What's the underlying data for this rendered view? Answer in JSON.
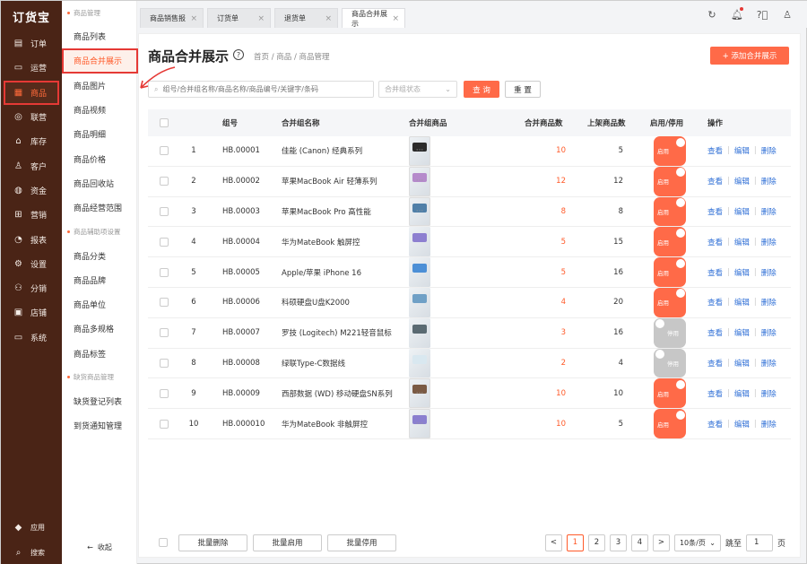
{
  "brand": "订货宝",
  "nav": [
    {
      "icon": "orders-icon",
      "glyph": "▤",
      "label": "订单"
    },
    {
      "icon": "operations-icon",
      "glyph": "▭",
      "label": "运营"
    },
    {
      "icon": "products-icon",
      "glyph": "▦",
      "label": "商品"
    },
    {
      "icon": "alliance-icon",
      "glyph": "◎",
      "label": "联营"
    },
    {
      "icon": "warehouse-icon",
      "glyph": "⌂",
      "label": "库存"
    },
    {
      "icon": "customer-icon",
      "glyph": "♙",
      "label": "客户"
    },
    {
      "icon": "funds-icon",
      "glyph": "◍",
      "label": "资金"
    },
    {
      "icon": "marketing-icon",
      "glyph": "⊞",
      "label": "营销"
    },
    {
      "icon": "report-icon",
      "glyph": "◔",
      "label": "报表"
    },
    {
      "icon": "settings-icon",
      "glyph": "⚙",
      "label": "设置"
    },
    {
      "icon": "distribution-icon",
      "glyph": "⚇",
      "label": "分销"
    },
    {
      "icon": "store-icon",
      "glyph": "▣",
      "label": "店铺"
    },
    {
      "icon": "system-icon",
      "glyph": "▭",
      "label": "系统"
    }
  ],
  "nav_bottom": [
    {
      "icon": "apps-icon",
      "glyph": "◆",
      "label": "应用"
    },
    {
      "icon": "search-icon",
      "glyph": "⌕",
      "label": "搜索"
    }
  ],
  "sub": {
    "group1": "商品管理",
    "group1_items": [
      "商品列表",
      "商品合并展示",
      "商品图片",
      "商品视频",
      "商品明细",
      "商品价格",
      "商品回收站",
      "商品经营范围"
    ],
    "group2": "商品辅助项设置",
    "group2_items": [
      "商品分类",
      "商品品牌",
      "商品单位",
      "商品多规格",
      "商品标签"
    ],
    "group3": "缺货商品管理",
    "group3_items": [
      "缺货登记列表",
      "到货通知管理"
    ],
    "collapse": "收起"
  },
  "tabs": [
    {
      "label": "商品销售报",
      "close": "×"
    },
    {
      "label": "订货单",
      "close": "×"
    },
    {
      "label": "退货单",
      "close": "×"
    },
    {
      "label": "商品合并展示",
      "close": "×"
    }
  ],
  "page": {
    "title": "商品合并展示",
    "breadcrumb": "首页 / 商品 / 商品管理",
    "add_button": "+ 添加合并展示",
    "search_placeholder": "组号/合并组名称/商品名称/商品编号/关键字/条码",
    "status_placeholder": "合并组状态",
    "query_button": "查 询",
    "reset_button": "重 置"
  },
  "table": {
    "headers": {
      "code": "组号",
      "name": "合并组名称",
      "goods": "合并组商品",
      "count": "合并商品数",
      "shelf": "上架商品数",
      "status": "启用/停用",
      "ops": "操作"
    },
    "on_label": "启用",
    "off_label": "停用",
    "op_view": "查看",
    "op_edit": "编辑",
    "op_delete": "删除",
    "more": "···",
    "rows": [
      {
        "idx": "1",
        "code": "HB.00001",
        "name": "佳能 (Canon) 经典系列",
        "count": "10",
        "shelf": "5",
        "on": true,
        "thumbs": [
          "#3a3a3a",
          "#6fa6c9",
          "#2b2b2b"
        ],
        "more": true
      },
      {
        "idx": "2",
        "code": "HB.00002",
        "name": "苹果MacBook Air 轻薄系列",
        "count": "12",
        "shelf": "12",
        "on": true,
        "thumbs": [
          "#3c4f7a",
          "#c9b79c",
          "#b58acb"
        ],
        "more": true
      },
      {
        "idx": "3",
        "code": "HB.00003",
        "name": "苹果MacBook Pro 高性能",
        "count": "8",
        "shelf": "8",
        "on": true,
        "thumbs": [
          "#2e3c5c",
          "#8fb3c9",
          "#4f7fa8"
        ],
        "more": true
      },
      {
        "idx": "4",
        "code": "HB.00004",
        "name": "华为MateBook 触屏控",
        "count": "5",
        "shelf": "15",
        "on": true,
        "thumbs": [
          "#8fc1d9",
          "#e59a4a",
          "#8d7fd0"
        ],
        "more": false
      },
      {
        "idx": "5",
        "code": "HB.00005",
        "name": "Apple/苹果 iPhone 16",
        "count": "5",
        "shelf": "16",
        "on": true,
        "thumbs": [
          "#5f7fc9",
          "#6b4fb8",
          "#4c8fd6"
        ],
        "more": false
      },
      {
        "idx": "6",
        "code": "HB.00006",
        "name": "科硕硬盘U盘K2000",
        "count": "4",
        "shelf": "20",
        "on": true,
        "thumbs": [
          "#3d4b58",
          "#2a2a2a",
          "#6fa0c6"
        ],
        "more": false
      },
      {
        "idx": "7",
        "code": "HB.00007",
        "name": "罗技 (Logitech) M221轻音鼠标",
        "count": "3",
        "shelf": "16",
        "on": false,
        "thumbs": [
          "#b9b9b9",
          "#5a6a72"
        ],
        "more": false
      },
      {
        "idx": "8",
        "code": "HB.00008",
        "name": "绿联Type-C数据线",
        "count": "2",
        "shelf": "4",
        "on": false,
        "thumbs": [
          "#9fc8dc",
          "#d9e8f0"
        ],
        "more": false
      },
      {
        "idx": "9",
        "code": "HB.00009",
        "name": "西部数据 (WD) 移动硬盘SN系列",
        "count": "10",
        "shelf": "10",
        "on": true,
        "thumbs": [
          "#aab8c4",
          "#3f6e8a",
          "#7a5a44"
        ],
        "more": true
      },
      {
        "idx": "10",
        "code": "HB.000010",
        "name": "华为MateBook 非触屏控",
        "count": "10",
        "shelf": "5",
        "on": true,
        "thumbs": [
          "#6a5aa8",
          "#4a8fc0",
          "#8a7fcf"
        ],
        "more": true
      }
    ]
  },
  "footer": {
    "batch_delete": "批量删除",
    "batch_enable": "批量启用",
    "batch_disable": "批量停用",
    "prev": "<",
    "next": ">",
    "pages": [
      "1",
      "2",
      "3",
      "4"
    ],
    "current_page": "1",
    "page_size": "10条/页",
    "jump_label": "跳至",
    "jump_value": "1",
    "page_unit": "页"
  },
  "colors": {
    "accent": "#ff6a48",
    "nav_bg": "#4a2416",
    "highlight": "#e53935",
    "link": "#2f6fd6"
  }
}
